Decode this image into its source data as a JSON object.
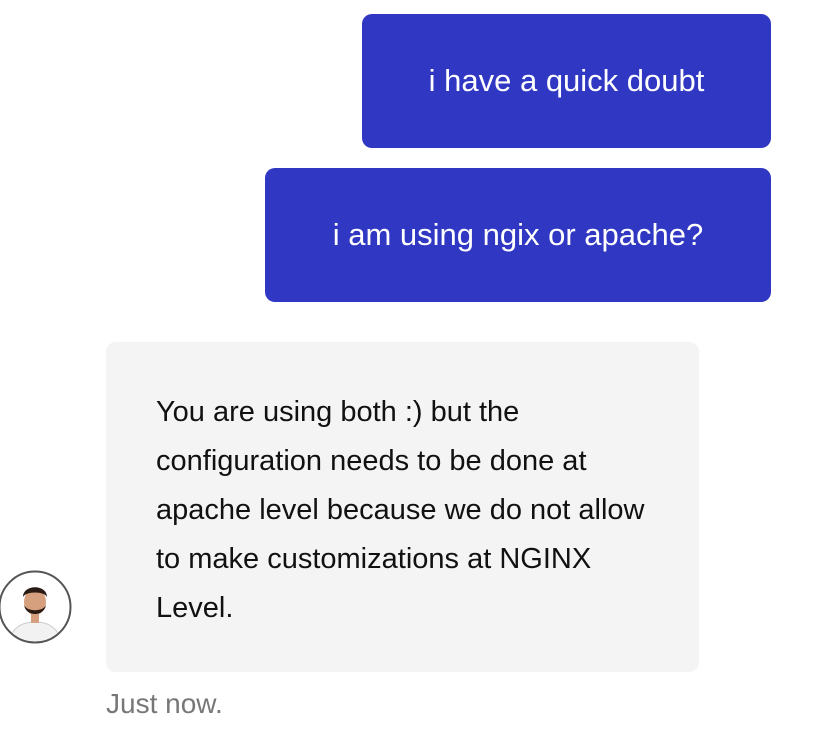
{
  "conversation": {
    "messages": [
      {
        "sender": "user",
        "text": "i have a quick doubt"
      },
      {
        "sender": "user",
        "text": "i am using ngix or apache?"
      },
      {
        "sender": "agent",
        "text": "You are using both :) but the configuration needs to be done at apache level because we do not allow to make customizations at NGINX Level."
      }
    ],
    "agent_avatar_icon": "person-avatar-icon",
    "timestamp": "Just now."
  },
  "colors": {
    "user_bubble": "#2f37c3",
    "agent_bubble": "#f4f4f4",
    "timestamp_text": "#777777"
  }
}
